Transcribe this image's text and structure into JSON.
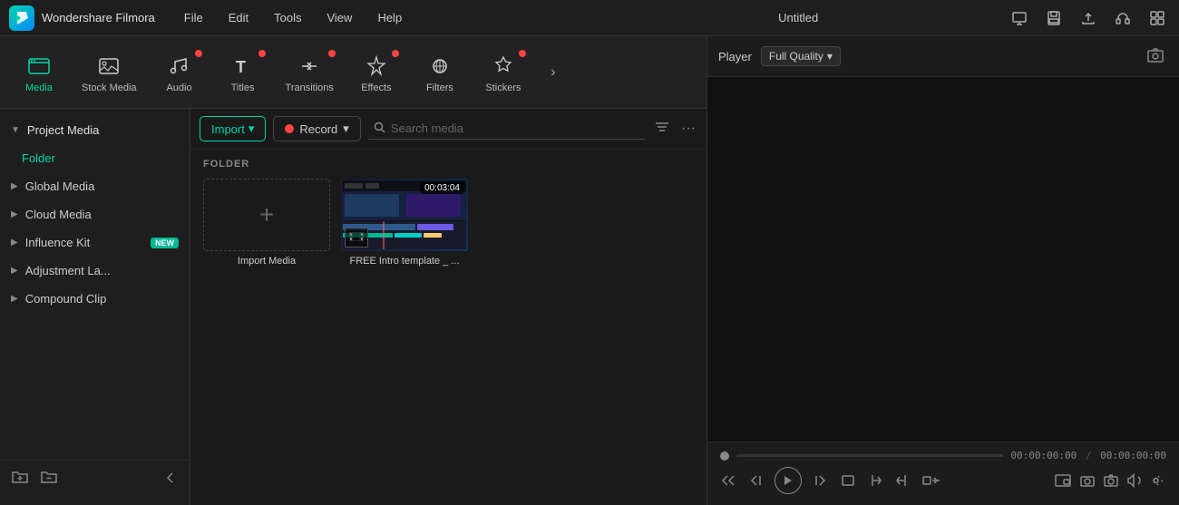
{
  "app": {
    "name": "Wondershare Filmora",
    "logo_letter": "F",
    "window_title": "Untitled"
  },
  "menu": {
    "items": [
      "File",
      "Edit",
      "Tools",
      "View",
      "Help"
    ]
  },
  "toolbar": {
    "tabs": [
      {
        "id": "media",
        "label": "Media",
        "icon": "🎬",
        "active": true,
        "dot": false
      },
      {
        "id": "stock",
        "label": "Stock Media",
        "icon": "🖼",
        "active": false,
        "dot": false
      },
      {
        "id": "audio",
        "label": "Audio",
        "icon": "♪",
        "active": false,
        "dot": true
      },
      {
        "id": "titles",
        "label": "Titles",
        "icon": "T",
        "active": false,
        "dot": true
      },
      {
        "id": "transitions",
        "label": "Transitions",
        "icon": "⇄",
        "active": false,
        "dot": true
      },
      {
        "id": "effects",
        "label": "Effects",
        "icon": "✦",
        "active": false,
        "dot": true
      },
      {
        "id": "filters",
        "label": "Filters",
        "icon": "🎨",
        "active": false,
        "dot": false
      },
      {
        "id": "stickers",
        "label": "Stickers",
        "icon": "★",
        "active": false,
        "dot": true
      }
    ]
  },
  "sidebar": {
    "project_media_label": "Project Media",
    "folder_label": "Folder",
    "items": [
      {
        "id": "global-media",
        "label": "Global Media"
      },
      {
        "id": "cloud-media",
        "label": "Cloud Media"
      },
      {
        "id": "influence-kit",
        "label": "Influence Kit",
        "badge": "NEW"
      },
      {
        "id": "adjustment-layer",
        "label": "Adjustment La..."
      },
      {
        "id": "compound-clip",
        "label": "Compound Clip"
      }
    ],
    "footer_buttons": [
      {
        "id": "add-folder",
        "icon": "□+"
      },
      {
        "id": "remove-folder",
        "icon": "□-"
      }
    ]
  },
  "content": {
    "import_label": "Import",
    "record_label": "Record",
    "search_placeholder": "Search media",
    "folder_header": "FOLDER",
    "import_media_label": "Import Media",
    "video_label": "FREE Intro template _ ...",
    "video_duration": "00:03:04"
  },
  "player": {
    "label": "Player",
    "quality": "Full Quality",
    "time_current": "00:00:00:00",
    "time_total": "00:00:00:00",
    "time_separator": "/"
  },
  "window_controls": {
    "monitor_icon": "⬜",
    "save_icon": "💾",
    "upload_icon": "⬆",
    "headphone_icon": "🎧",
    "grid_icon": "⊞"
  }
}
